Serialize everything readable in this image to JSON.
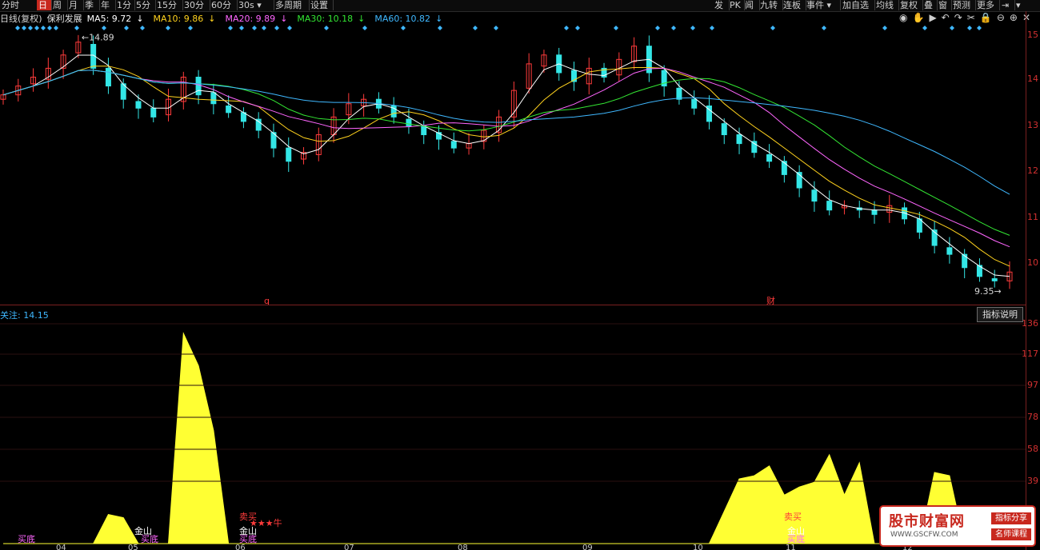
{
  "toolbar": {
    "items": [
      {
        "label": "分时",
        "active": false
      },
      {
        "label": "日",
        "active": true
      },
      {
        "label": "周",
        "active": false
      },
      {
        "label": "月",
        "active": false
      },
      {
        "label": "季",
        "active": false
      },
      {
        "label": "年",
        "active": false
      },
      {
        "label": "1分",
        "active": false
      },
      {
        "label": "5分",
        "active": false
      },
      {
        "label": "15分",
        "active": false
      },
      {
        "label": "30分",
        "active": false
      },
      {
        "label": "60分",
        "active": false
      },
      {
        "label": "30s",
        "active": false
      },
      {
        "label": "多周期",
        "active": false
      },
      {
        "label": "设置",
        "active": false
      }
    ],
    "right_items": [
      "发",
      "PK",
      "闻",
      "九转",
      "连板",
      "事件",
      "加自选",
      "均线",
      "复权",
      "叠",
      "窗",
      "预测",
      "更多"
    ]
  },
  "legend": {
    "period": "日线(复权)",
    "stock": "保利发展",
    "ma5": "MA5: 9.72",
    "ma10": "MA10: 9.86",
    "ma20": "MA20: 9.89",
    "ma30": "MA30: 10.18",
    "ma60": "MA60: 10.82",
    "arrow": "↓",
    "colors": {
      "ma5": "#ffffff",
      "ma10": "#ffd21e",
      "ma20": "#ff66ff",
      "ma30": "#33e633",
      "ma60": "#3fb8ff",
      "up": "#ff3b3b",
      "down": "#33e6e6"
    }
  },
  "price_axis": [
    "15",
    "14",
    "13",
    "12",
    "11",
    "10"
  ],
  "indicator_axis": [
    "136",
    "117",
    "97",
    "78",
    "58",
    "39"
  ],
  "chart_annotations": {
    "high": "14.89",
    "low": "9.35",
    "mark_q": "q",
    "mark_cai": "财"
  },
  "indicator": {
    "title": "关注: 14.15",
    "explain_button": "指标说明",
    "labels": {
      "buy_bottom": "买底",
      "gold_mountain": "金山",
      "buy_bottom2": "买底",
      "sell_buy": "卖买",
      "star_cow": "★★★牛"
    }
  },
  "dates": [
    "04",
    "05",
    "06",
    "07",
    "08",
    "09",
    "10",
    "11",
    "12"
  ],
  "watermark": {
    "title": "股市财富网",
    "url": "WWW.GSCFW.COM",
    "tag1": "指标分享",
    "tag2": "名师课程"
  },
  "chart_data": {
    "type": "candlestick",
    "ylim": [
      9.2,
      15.3
    ],
    "xlabels": [
      "04",
      "05",
      "06",
      "07",
      "08",
      "09",
      "10",
      "11",
      "12"
    ],
    "close_approx": [
      13.7,
      13.9,
      14.1,
      14.3,
      14.6,
      14.89,
      14.3,
      13.9,
      13.6,
      13.4,
      13.2,
      13.6,
      14.1,
      13.7,
      13.5,
      13.3,
      13.1,
      12.9,
      12.5,
      12.2,
      12.4,
      12.8,
      13.2,
      13.5,
      13.6,
      13.4,
      13.2,
      13.0,
      12.8,
      12.7,
      12.5,
      12.6,
      12.9,
      13.2,
      13.8,
      14.4,
      14.6,
      14.2,
      14.0,
      14.3,
      14.1,
      14.5,
      14.8,
      14.2,
      13.9,
      13.6,
      13.4,
      13.1,
      12.8,
      12.6,
      12.4,
      12.2,
      11.9,
      11.6,
      11.3,
      11.1,
      11.2,
      11.1,
      11.0,
      11.2,
      10.9,
      10.6,
      10.3,
      10.1,
      9.8,
      9.6,
      9.5,
      9.7
    ],
    "indicator_values_approx": [
      0,
      0,
      0,
      0,
      0,
      0,
      0,
      18,
      16,
      0,
      0,
      0,
      130,
      110,
      70,
      0,
      0,
      0,
      0,
      0,
      0,
      0,
      0,
      0,
      0,
      0,
      0,
      0,
      0,
      0,
      0,
      0,
      0,
      0,
      0,
      0,
      0,
      0,
      0,
      0,
      0,
      0,
      0,
      0,
      0,
      0,
      0,
      0,
      20,
      40,
      42,
      48,
      30,
      35,
      38,
      55,
      30,
      50,
      0,
      0,
      0,
      0,
      44,
      42,
      0,
      0,
      0,
      0
    ]
  }
}
